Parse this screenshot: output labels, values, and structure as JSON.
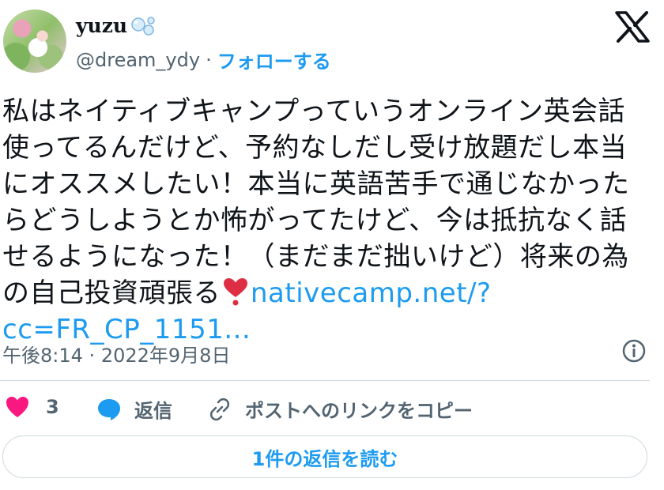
{
  "author": {
    "name": "yuzu",
    "handle": "@dream_ydy",
    "separator": "·",
    "follow_label": "フォローする"
  },
  "tweet": {
    "lines": [
      "私はネイティブキャンプっていうオンライン英会話",
      "使ってるんだけど、予約なしだし受け放題だし本当",
      "にオススメしたい！本当に英語苦手で通じなかった",
      "らどうしようとか怖がってたけど、今は抵抗なく話",
      "せるようになった！（まだまだ拙いけど）将来の為"
    ],
    "last_line_text": "の自己投資頑張る",
    "link_part1": "nativecamp.net/?",
    "link_part2": "cc=FR_CP_1151..."
  },
  "meta": {
    "time": "午後8:14",
    "separator": "·",
    "date": "2022年9月8日"
  },
  "actions": {
    "like_count": "3",
    "reply_label": "返信",
    "copy_link_label": "ポストへのリンクをコピー"
  },
  "read_replies_label": "1件の返信を読む",
  "colors": {
    "accent": "#1d9bf0",
    "text": "#0f1419",
    "muted": "#536471",
    "heart": "#f91880",
    "border": "#cfd9de"
  },
  "icons": [
    "bubbles-icon",
    "x-logo-icon",
    "heart-emoji-icon",
    "info-icon",
    "heart-icon",
    "reply-bubble-icon",
    "link-icon"
  ]
}
